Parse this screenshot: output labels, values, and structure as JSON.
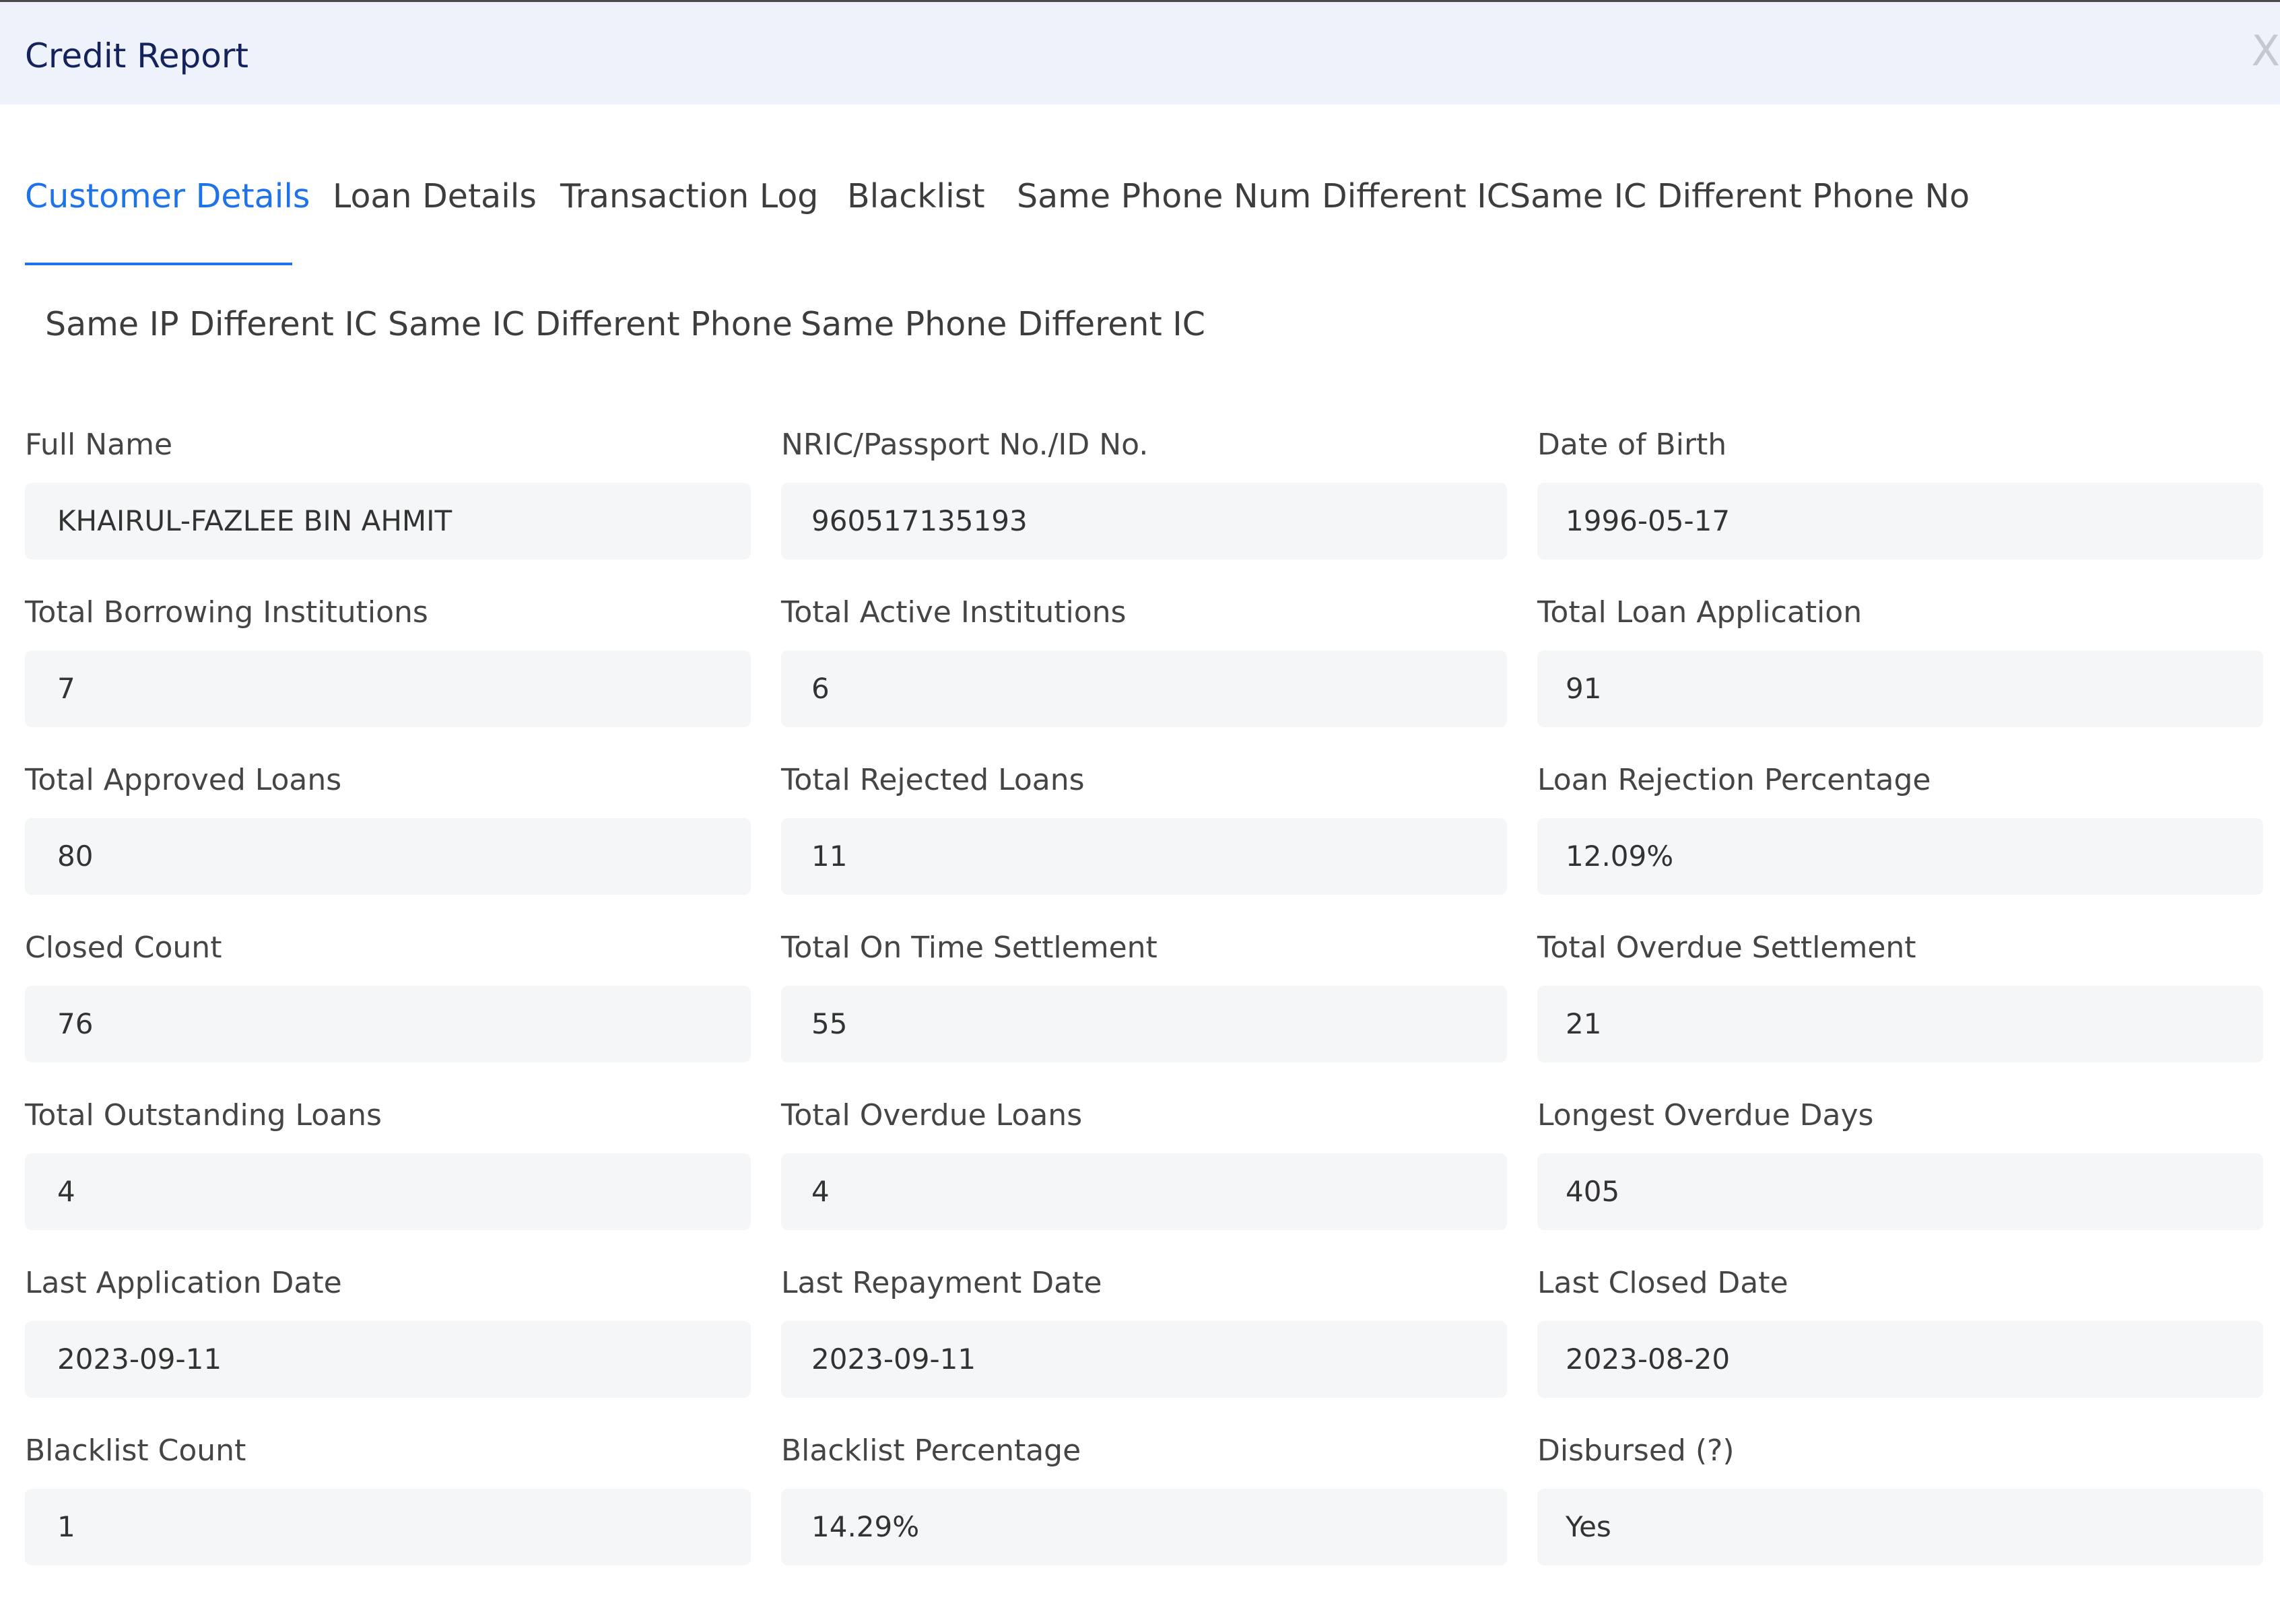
{
  "modal": {
    "title": "Credit Report",
    "close_label": "X"
  },
  "tabs": [
    {
      "label": "Customer Details",
      "active": true
    },
    {
      "label": "Loan Details",
      "active": false
    },
    {
      "label": "Transaction Log",
      "active": false
    },
    {
      "label": "Blacklist",
      "active": false
    },
    {
      "label": "Same Phone Num Different IC",
      "active": false
    },
    {
      "label": "Same IC Different Phone No",
      "active": false
    },
    {
      "label": "Same IP Different IC",
      "active": false
    },
    {
      "label": "Same IC Different Phone",
      "active": false
    },
    {
      "label": "Same Phone Different IC",
      "active": false
    }
  ],
  "fields": [
    {
      "label": "Full Name",
      "value": "KHAIRUL-FAZLEE BIN AHMIT"
    },
    {
      "label": "NRIC/Passport No./ID No.",
      "value": "960517135193"
    },
    {
      "label": "Date of Birth",
      "value": "1996-05-17"
    },
    {
      "label": "Total Borrowing Institutions",
      "value": "7"
    },
    {
      "label": "Total Active Institutions",
      "value": "6"
    },
    {
      "label": "Total Loan Application",
      "value": "91"
    },
    {
      "label": "Total Approved Loans",
      "value": "80"
    },
    {
      "label": "Total Rejected Loans",
      "value": "11"
    },
    {
      "label": "Loan Rejection Percentage",
      "value": "12.09%"
    },
    {
      "label": "Closed Count",
      "value": "76"
    },
    {
      "label": "Total On Time Settlement",
      "value": "55"
    },
    {
      "label": "Total Overdue Settlement",
      "value": "21"
    },
    {
      "label": "Total Outstanding Loans",
      "value": "4"
    },
    {
      "label": "Total Overdue Loans",
      "value": "4"
    },
    {
      "label": "Longest Overdue Days",
      "value": "405"
    },
    {
      "label": "Last Application Date",
      "value": "2023-09-11"
    },
    {
      "label": "Last Repayment Date",
      "value": "2023-09-11"
    },
    {
      "label": "Last Closed Date",
      "value": "2023-08-20"
    },
    {
      "label": "Blacklist Count",
      "value": "1"
    },
    {
      "label": "Blacklist Percentage",
      "value": "14.29%"
    },
    {
      "label": "Disbursed (?)",
      "value": "Yes"
    }
  ]
}
